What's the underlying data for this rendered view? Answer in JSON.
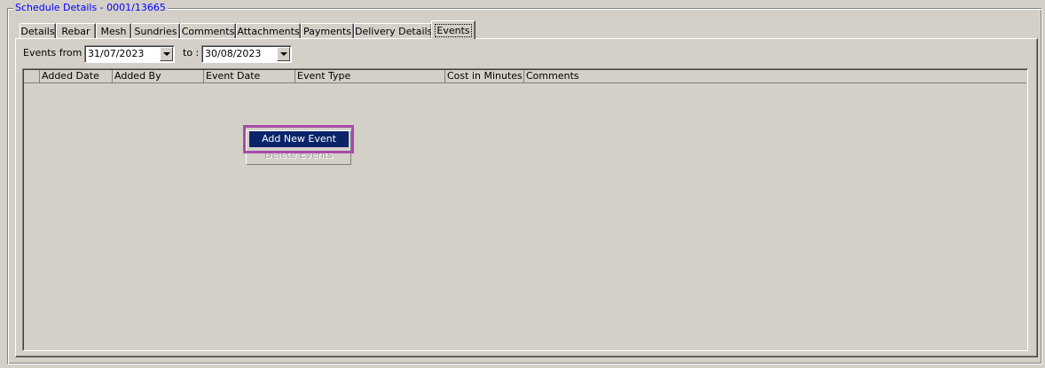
{
  "group": {
    "title": "Schedule Details - 0001/13665"
  },
  "tabs": [
    {
      "label": "Details"
    },
    {
      "label": "Rebar"
    },
    {
      "label": "Mesh"
    },
    {
      "label": "Sundries"
    },
    {
      "label": "Comments"
    },
    {
      "label": "Attachments"
    },
    {
      "label": "Payments"
    },
    {
      "label": "Delivery Details"
    },
    {
      "label": "Events",
      "active": true
    }
  ],
  "filter": {
    "from_label": "Events from :",
    "from_value": "31/07/2023",
    "to_label": "to :",
    "to_value": "30/08/2023"
  },
  "grid": {
    "columns": [
      "Added Date",
      "Added By",
      "Event Date",
      "Event Type",
      "Cost in Minutes",
      "Comments"
    ],
    "rows": []
  },
  "context_menu": {
    "items": [
      {
        "label": "Add New Event",
        "enabled": true,
        "highlighted": true
      },
      {
        "label": "Delete Events",
        "enabled": false
      }
    ]
  },
  "colors": {
    "title": "#0000ff",
    "selection": "#0a246a",
    "annotation_ring": "#a64ca6",
    "background": "#d4d0c8"
  }
}
